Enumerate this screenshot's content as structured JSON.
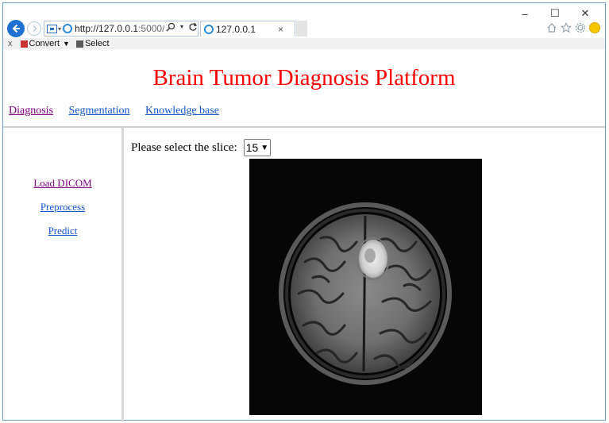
{
  "browser": {
    "address_url_main": "http://127.0.0.1",
    "address_url_rest": ":5000/",
    "tab_title": "127.0.0.1",
    "tab_close": "×",
    "window_controls": {
      "minimize": "–",
      "maximize": "☐",
      "close": "✕"
    },
    "command_bar": {
      "close": "x",
      "convert_label": "Convert",
      "convert_dropdown": "▼",
      "select_label": "Select"
    },
    "icons": [
      "back-icon",
      "forward-icon",
      "compatibility-view-icon",
      "ie-icon",
      "search-icon",
      "refresh-icon",
      "home-icon",
      "favorites-star-icon",
      "settings-gear-icon",
      "smiley-feedback-icon"
    ]
  },
  "page": {
    "title": "Brain Tumor Diagnosis Platform",
    "nav": [
      {
        "label": "Diagnosis",
        "state": "visited"
      },
      {
        "label": "Segmentation",
        "state": "link"
      },
      {
        "label": "Knowledge base",
        "state": "link"
      }
    ],
    "sidebar": [
      {
        "label": "Load DICOM",
        "state": "visited"
      },
      {
        "label": "Preprocess",
        "state": "link"
      },
      {
        "label": "Predict",
        "state": "link"
      }
    ],
    "slice_label": "Please select the slice:",
    "slice_value": "15"
  },
  "colors": {
    "title": "#ff0000",
    "link": "#1155cc",
    "visited": "#800080",
    "frame_border": "#6b9ec9"
  }
}
